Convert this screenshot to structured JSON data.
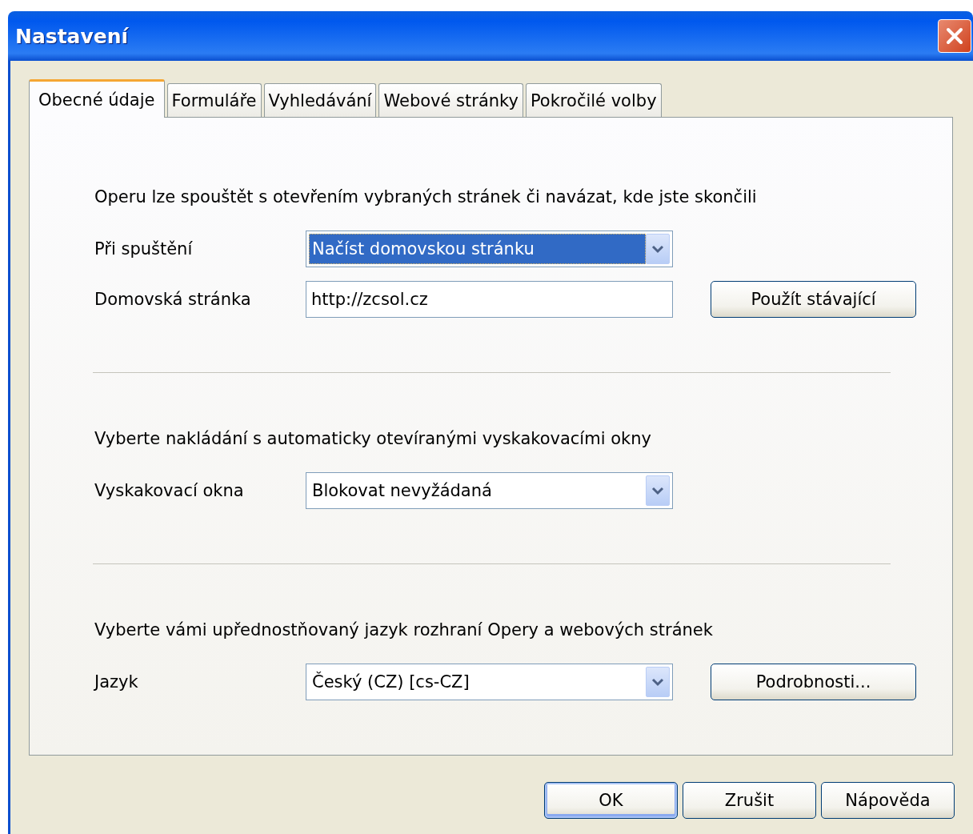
{
  "window": {
    "title": "Nastavení"
  },
  "tabs": [
    {
      "label": "Obecné údaje",
      "selected": true
    },
    {
      "label": "Formuláře",
      "selected": false
    },
    {
      "label": "Vyhledávání",
      "selected": false
    },
    {
      "label": "Webové stránky",
      "selected": false
    },
    {
      "label": "Pokročilé volby",
      "selected": false
    }
  ],
  "sections": [
    {
      "description": "Operu lze spouštět s otevřením vybraných stránek či navázat, kde jste skončili",
      "rows": [
        {
          "kind": "combo",
          "label": "Při spuštění",
          "value": "Načíst domovskou stránku",
          "focused": true
        },
        {
          "kind": "text",
          "label": "Domovská stránka",
          "value": "http://zcsol.cz",
          "focused": false,
          "button": "Použít stávající"
        }
      ]
    },
    {
      "description": "Vyberte nakládání s automaticky otevíranými vyskakovacími okny",
      "rows": [
        {
          "kind": "combo",
          "label": "Vyskakovací okna",
          "value": "Blokovat nevyžádaná",
          "focused": false
        }
      ]
    },
    {
      "description": "Vyberte vámi upřednostňovaný jazyk rozhraní Opery a webových stránek",
      "rows": [
        {
          "kind": "combo",
          "label": "Jazyk",
          "value": "Český (CZ) [cs-CZ]",
          "focused": false,
          "button": "Podrobnosti..."
        }
      ]
    }
  ],
  "buttons": [
    {
      "label": "OK",
      "default": true
    },
    {
      "label": "Zrušit",
      "default": false
    },
    {
      "label": "Nápověda",
      "default": false
    }
  ]
}
